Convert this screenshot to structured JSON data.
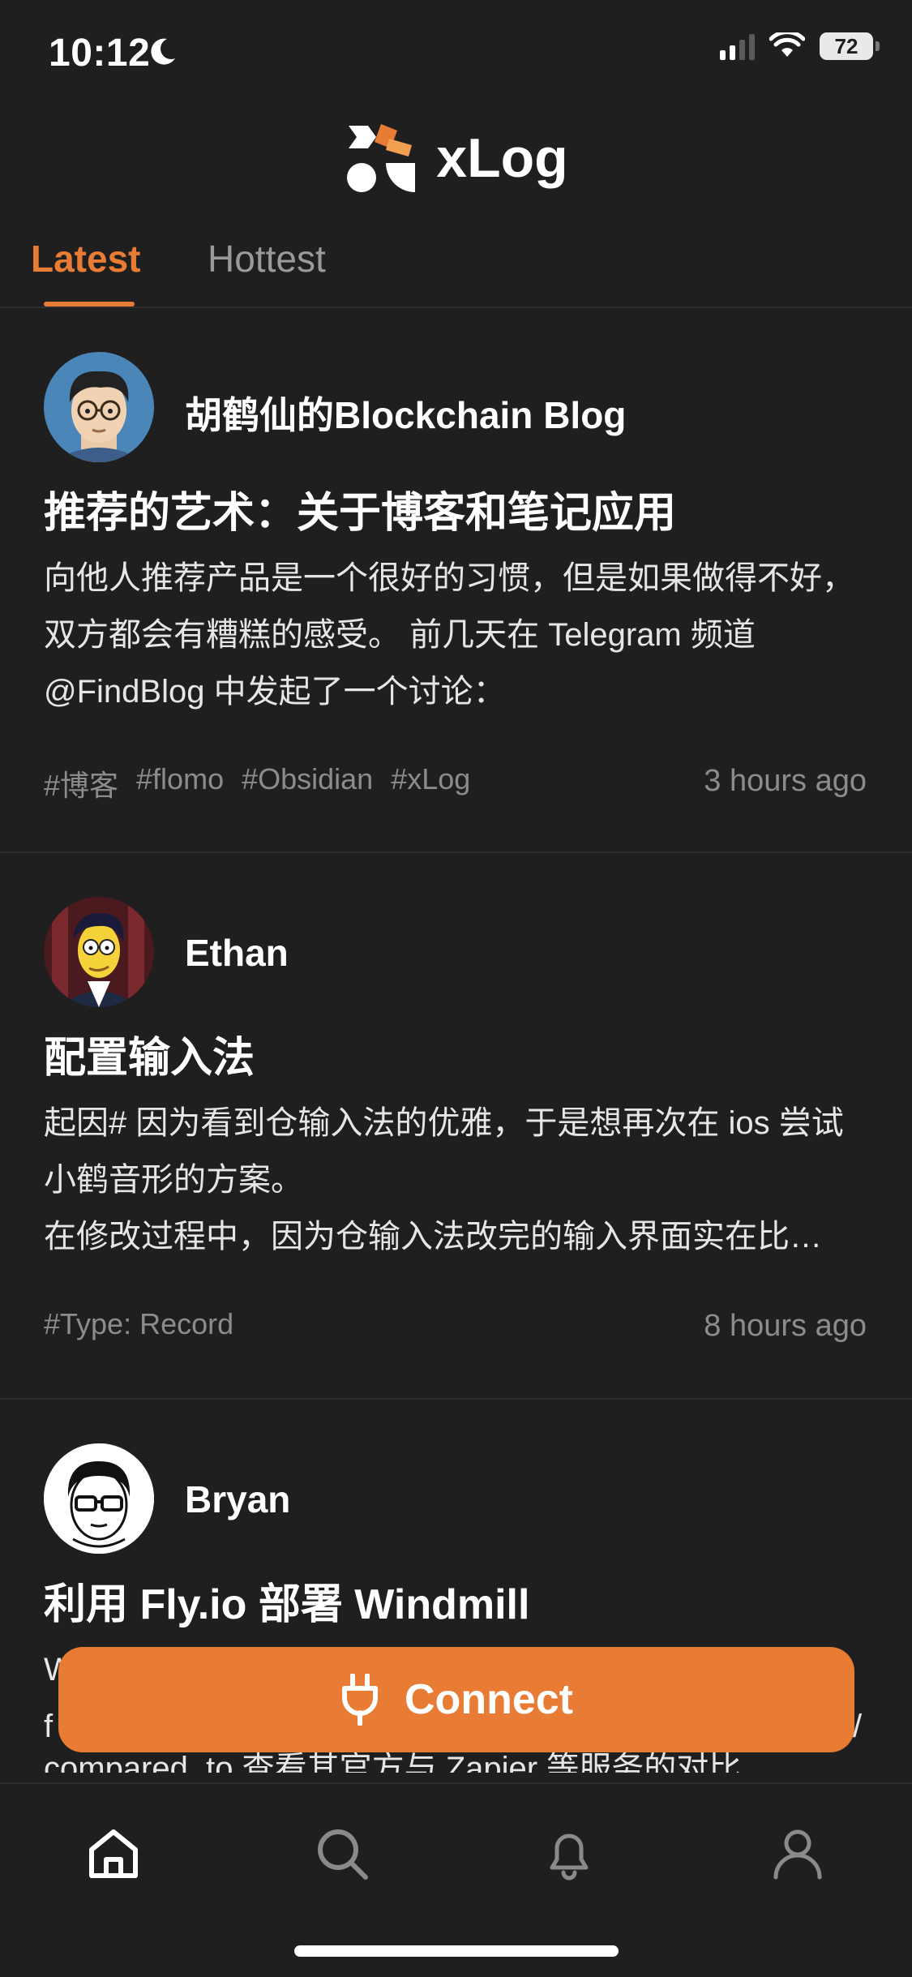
{
  "status_bar": {
    "time": "10:12",
    "battery": "72"
  },
  "app": {
    "brand_name": "xLog",
    "accent_color": "#e87c35"
  },
  "tabs": [
    {
      "label": "Latest",
      "active": true
    },
    {
      "label": "Hottest",
      "active": false
    }
  ],
  "posts": [
    {
      "author": "胡鹤仙的Blockchain Blog",
      "title": "推荐的艺术：关于博客和笔记应用",
      "excerpt": "向他人推荐产品是一个很好的习惯，但是如果做得不好，双方都会有糟糕的感受。 前几天在 Telegram 频道 @FindBlog 中发起了一个讨论：",
      "tags": [
        "#博客",
        "#flomo",
        "#Obsidian",
        "#xLog"
      ],
      "time_ago": "3 hours ago",
      "avatar_icon": "cartoon-man-glasses-avatar"
    },
    {
      "author": "Ethan",
      "title": "配置输入法",
      "excerpt": "起因# 因为看到仓输入法的优雅，于是想再次在 ios 尝试小鹤音形的方案。\n在修改过程中，因为仓输入法改完的输入界面实在比…",
      "tags": [
        "#Type: Record"
      ],
      "time_ago": "8 hours ago",
      "avatar_icon": "simpsons-character-avatar"
    },
    {
      "author": "Bryan",
      "title": "利用 Fly.io 部署 Windmill",
      "excerpt_hidden_start": "W",
      "excerpt_line2_start": "f",
      "excerpt_line2_end": "/",
      "excerpt_line3": "compared_to 查看其官方与 Zapier 等服务的对比",
      "avatar_icon": "sketch-man-glasses-avatar"
    }
  ],
  "connect_button": {
    "label": "Connect",
    "icon": "plug-icon"
  },
  "bottom_nav": [
    {
      "name": "home",
      "icon": "home-icon",
      "active": true
    },
    {
      "name": "search",
      "icon": "search-icon",
      "active": false
    },
    {
      "name": "notifications",
      "icon": "bell-icon",
      "active": false
    },
    {
      "name": "profile",
      "icon": "user-icon",
      "active": false
    }
  ]
}
